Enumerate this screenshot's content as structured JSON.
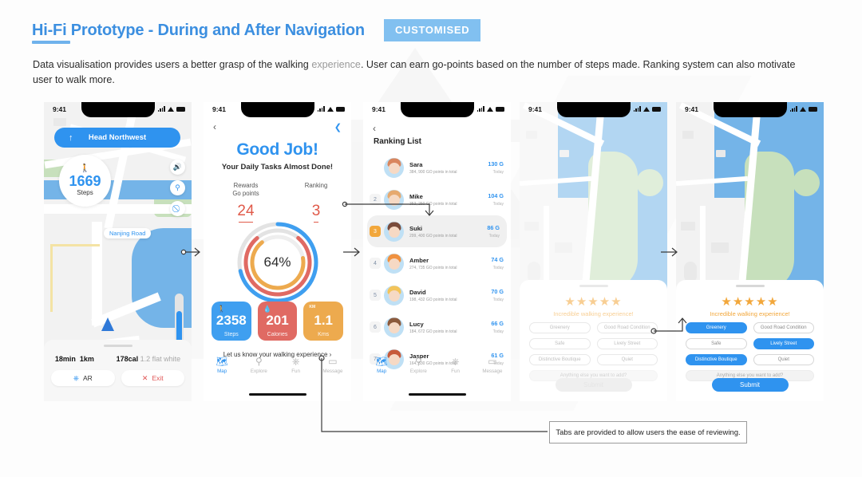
{
  "header": {
    "title": "Hi-Fi Prototype - During and After Navigation",
    "badge": "CUSTOMISED",
    "description_1": "Data visualisation provides users a better grasp of the walking ",
    "description_muted": "experience",
    "description_2": ". User can earn go-points based on the number of steps made. Ranking system can also motivate user to walk more."
  },
  "colors": {
    "accent_blue": "#2f93ef",
    "title_blue": "#3c8fe0",
    "badge_blue": "#81c0f0",
    "red": "#e05a4a",
    "orange": "#f2a73b",
    "water": "#74b4e8",
    "green": "#c7e0bc"
  },
  "status_bar": {
    "time": "9:41"
  },
  "screen1": {
    "nav_label": "Head Northwest",
    "nav_arrow": "↑",
    "steps_value": "1669",
    "steps_label": "Steps",
    "walk_icon": "walking-person-icon",
    "side_buttons": [
      "volume-icon",
      "search-icon",
      "no-entry-icon"
    ],
    "road_label": "Nanjing Road",
    "stats": {
      "time": "18min",
      "distance": "1km",
      "calories": "178cal",
      "equiv": "1.2 flat white"
    },
    "buttons": {
      "ar": "AR",
      "exit": "Exit"
    }
  },
  "screen2": {
    "back_icon": "chevron-left-icon",
    "share_icon": "share-icon",
    "title": "Good Job!",
    "subtitle": "Your Daily Tasks Almost Done!",
    "rewards_caption_1": "Rewards",
    "rewards_caption_2": "Go points",
    "rewards_value": "24",
    "ranking_caption": "Ranking",
    "ranking_value": "3",
    "donut_percent": "64%",
    "cards": [
      {
        "icon": "walking-person-icon",
        "value": "2358",
        "label": "Steps",
        "color": "#3f9ff0"
      },
      {
        "icon": "flame-icon",
        "value": "201",
        "label": "Calories",
        "color": "#e06a63"
      },
      {
        "icon": "KM",
        "value": "1.1",
        "label": "Kms",
        "color": "#edaa4e"
      }
    ],
    "feedback_prompt": "Let us know your walking experience  ›",
    "tabs": [
      {
        "icon": "map-icon",
        "label": "Map",
        "active": true
      },
      {
        "icon": "search-icon",
        "label": "Explore",
        "active": false
      },
      {
        "icon": "box-icon",
        "label": "Fun",
        "active": false
      },
      {
        "icon": "message-icon",
        "label": "Message",
        "active": false
      }
    ]
  },
  "screen3": {
    "back_icon": "chevron-left-icon",
    "title": "Ranking List",
    "rows": [
      {
        "rank": "",
        "name": "Sara",
        "sub": "384, 900 GO points in total",
        "points": "130 G",
        "today": "Today",
        "hair": "#d9865e",
        "highlight": false
      },
      {
        "rank": "2",
        "name": "Mike",
        "sub": "353, 250 GO points in total",
        "points": "104 G",
        "today": "Today",
        "hair": "#e6a96f",
        "highlight": false
      },
      {
        "rank": "3",
        "name": "Suki",
        "sub": "299, 400 GO points in total",
        "points": "86 G",
        "today": "Today",
        "hair": "#7a4b3a",
        "highlight": true
      },
      {
        "rank": "4",
        "name": "Amber",
        "sub": "274, 735 GO points in total",
        "points": "74 G",
        "today": "Today",
        "hair": "#f0913f",
        "highlight": false
      },
      {
        "rank": "5",
        "name": "David",
        "sub": "198, 432 GO points in total",
        "points": "70 G",
        "today": "Today",
        "hair": "#f3c45a",
        "highlight": false
      },
      {
        "rank": "6",
        "name": "Lucy",
        "sub": "184, 672 GO points in total",
        "points": "66 G",
        "today": "Today",
        "hair": "#8c5a3c",
        "highlight": false
      },
      {
        "rank": "7",
        "name": "Jasper",
        "sub": "164, 330 GO points in total",
        "points": "61 G",
        "today": "Today",
        "hair": "#c75a3a",
        "highlight": false
      }
    ],
    "tabs": [
      {
        "icon": "map-icon",
        "label": "Map",
        "active": true
      },
      {
        "icon": "search-icon",
        "label": "Explore",
        "active": false
      },
      {
        "icon": "box-icon",
        "label": "Fun",
        "active": false
      },
      {
        "icon": "message-icon",
        "label": "Message",
        "active": false
      }
    ]
  },
  "screen4": {
    "stars": "★★★★★",
    "star_caption": "Incredible walking experience!",
    "tags": [
      {
        "label": "Greenery",
        "selected": false
      },
      {
        "label": "Good Road Condition",
        "selected": false
      },
      {
        "label": "Safe",
        "selected": false
      },
      {
        "label": "Lively Street",
        "selected": false
      },
      {
        "label": "Distinctive Boutique",
        "selected": false
      },
      {
        "label": "Quiet",
        "selected": false
      }
    ],
    "extra_placeholder": "Anything else you want to add?",
    "submit": "Submit"
  },
  "screen5": {
    "stars": "★★★★★",
    "star_caption": "Incredible walking experience!",
    "tags": [
      {
        "label": "Greenery",
        "selected": true
      },
      {
        "label": "Good Road Condition",
        "selected": false
      },
      {
        "label": "Safe",
        "selected": false
      },
      {
        "label": "Lively Street",
        "selected": true
      },
      {
        "label": "Distinctive Boutique",
        "selected": true
      },
      {
        "label": "Quiet",
        "selected": false
      }
    ],
    "extra_placeholder": "Anything else you want to add?",
    "submit": "Submit"
  },
  "annotation": {
    "text": "Tabs are provided to allow users the ease of reviewing."
  }
}
